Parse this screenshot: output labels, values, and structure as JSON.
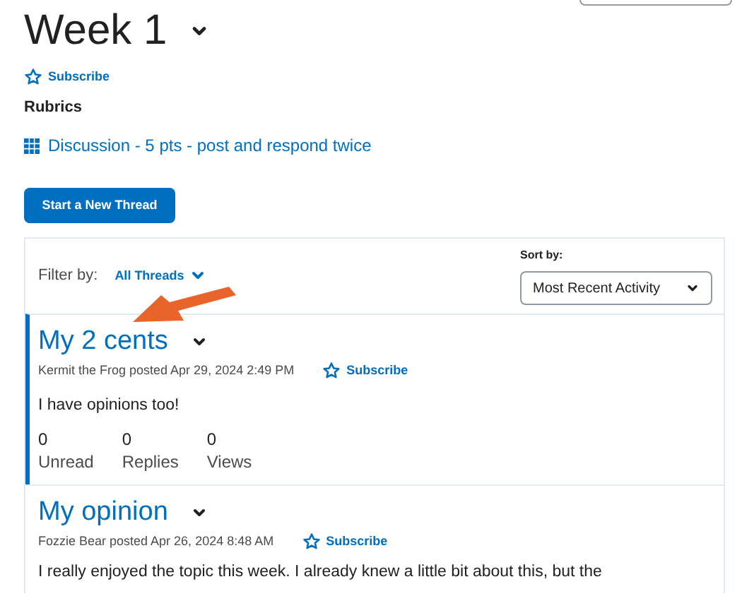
{
  "topic": {
    "title": "Week 1",
    "subscribe": "Subscribe"
  },
  "rubrics": {
    "heading": "Rubrics",
    "link": "Discussion - 5 pts - post and respond twice"
  },
  "start_button": "Start a New Thread",
  "filter": {
    "label": "Filter by:",
    "value": "All Threads"
  },
  "sort": {
    "label": "Sort by:",
    "value": "Most Recent Activity"
  },
  "threads": [
    {
      "title": "My 2 cents",
      "byline": "Kermit the Frog posted Apr 29, 2024 2:49 PM",
      "subscribe": "Subscribe",
      "body": "I have opinions too!",
      "selected": true,
      "stats": [
        {
          "value": "0",
          "label": "Unread"
        },
        {
          "value": "0",
          "label": "Replies"
        },
        {
          "value": "0",
          "label": "Views"
        }
      ]
    },
    {
      "title": "My opinion",
      "byline": "Fozzie Bear posted Apr 26, 2024 8:48 AM",
      "subscribe": "Subscribe",
      "body": "I really enjoyed the topic this week. I already knew a little bit about this, but the",
      "selected": false
    }
  ]
}
